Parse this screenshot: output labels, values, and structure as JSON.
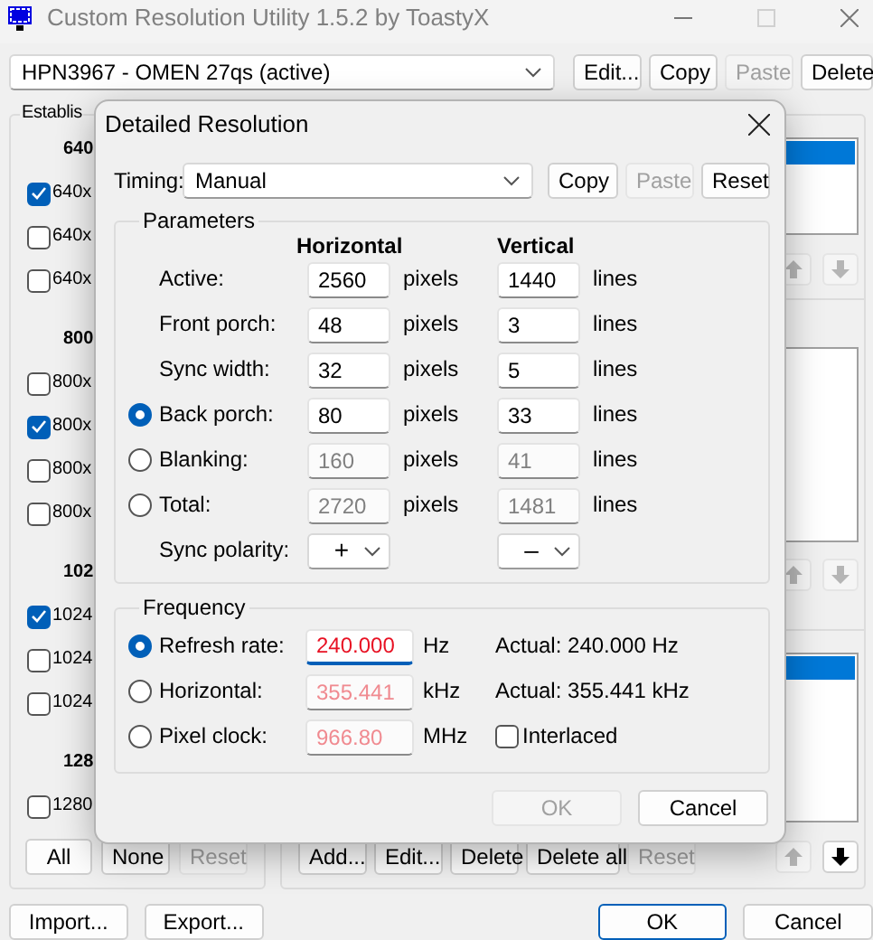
{
  "window": {
    "title": "Custom Resolution Utility 1.5.2 by ToastyX",
    "maximize_disabled": true
  },
  "monitor": {
    "value": "HPN3967 - OMEN 27qs (active)"
  },
  "monitor_buttons": [
    {
      "label": "Edit...",
      "disabled": false
    },
    {
      "label": "Copy",
      "disabled": false
    },
    {
      "label": "Paste",
      "disabled": true
    },
    {
      "label": "Delete",
      "disabled": false
    }
  ],
  "established": {
    "title": "Establis",
    "groups": [
      {
        "header": "640",
        "items": [
          {
            "label": "640x",
            "checked": true
          },
          {
            "label": "640x",
            "checked": false
          },
          {
            "label": "640x",
            "checked": false
          }
        ]
      },
      {
        "header": "800",
        "items": [
          {
            "label": "800x",
            "checked": false
          },
          {
            "label": "800x",
            "checked": true
          },
          {
            "label": "800x",
            "checked": false
          },
          {
            "label": "800x",
            "checked": false
          }
        ]
      },
      {
        "header": "102",
        "items": [
          {
            "label": "1024",
            "checked": true
          },
          {
            "label": "1024",
            "checked": false
          },
          {
            "label": "1024",
            "checked": false
          }
        ]
      },
      {
        "header": "128",
        "items": [
          {
            "label": "1280",
            "checked": false
          }
        ]
      }
    ],
    "buttons": [
      {
        "label": "All",
        "disabled": false
      },
      {
        "label": "None",
        "disabled": false
      },
      {
        "label": "Reset",
        "disabled": true
      }
    ]
  },
  "right_panel": {
    "lists": [
      {
        "selected": true,
        "up_disabled": true,
        "down_disabled": true
      },
      {
        "selected": false,
        "up_disabled": true,
        "down_disabled": true
      },
      {
        "selected": true,
        "up_disabled": true,
        "down_disabled": false
      }
    ],
    "buttons": [
      {
        "label": "Add...",
        "disabled": false
      },
      {
        "label": "Edit...",
        "disabled": false
      },
      {
        "label": "Delete",
        "disabled": false
      },
      {
        "label": "Delete all",
        "disabled": false
      },
      {
        "label": "Reset",
        "disabled": true
      }
    ]
  },
  "bottom_buttons": [
    {
      "label": "Import...",
      "default": false
    },
    {
      "label": "Export...",
      "default": false
    },
    {
      "label": "OK",
      "default": true
    },
    {
      "label": "Cancel",
      "default": false
    }
  ],
  "dialog": {
    "title": "Detailed Resolution",
    "timing": {
      "label": "Timing:",
      "value": "Manual"
    },
    "timing_buttons": [
      {
        "label": "Copy",
        "disabled": false
      },
      {
        "label": "Paste",
        "disabled": true
      },
      {
        "label": "Reset",
        "disabled": false
      }
    ],
    "parameters": {
      "title": "Parameters",
      "headers": [
        "Horizontal",
        "Vertical"
      ],
      "rows": [
        {
          "kind": "plain",
          "label": "Active:",
          "h_value": "2560",
          "h_unit": "pixels",
          "v_value": "1440",
          "v_unit": "lines",
          "disabled": false
        },
        {
          "kind": "plain",
          "label": "Front porch:",
          "h_value": "48",
          "h_unit": "pixels",
          "v_value": "3",
          "v_unit": "lines",
          "disabled": false
        },
        {
          "kind": "plain",
          "label": "Sync width:",
          "h_value": "32",
          "h_unit": "pixels",
          "v_value": "5",
          "v_unit": "lines",
          "disabled": false
        },
        {
          "kind": "radio",
          "selected": true,
          "label": "Back porch:",
          "h_value": "80",
          "h_unit": "pixels",
          "v_value": "33",
          "v_unit": "lines",
          "disabled": false
        },
        {
          "kind": "radio",
          "selected": false,
          "label": "Blanking:",
          "h_value": "160",
          "h_unit": "pixels",
          "v_value": "41",
          "v_unit": "lines",
          "disabled": true
        },
        {
          "kind": "radio",
          "selected": false,
          "label": "Total:",
          "h_value": "2720",
          "h_unit": "pixels",
          "v_value": "1481",
          "v_unit": "lines",
          "disabled": true
        }
      ],
      "polarity": {
        "label": "Sync polarity:",
        "h": "+",
        "v": "–"
      }
    },
    "frequency": {
      "title": "Frequency",
      "rows": [
        {
          "label": "Refresh rate:",
          "selected": true,
          "value": "240.000",
          "unit": "Hz",
          "disabled": false,
          "focused": true,
          "note": "Actual: 240.000 Hz"
        },
        {
          "label": "Horizontal:",
          "selected": false,
          "value": "355.441",
          "unit": "kHz",
          "disabled": true,
          "focused": false,
          "note": "Actual: 355.441 kHz"
        },
        {
          "label": "Pixel clock:",
          "selected": false,
          "value": "966.80",
          "unit": "MHz",
          "disabled": true,
          "focused": false,
          "checkbox": {
            "label": "Interlaced",
            "checked": false
          }
        }
      ]
    },
    "buttons": [
      {
        "label": "OK",
        "disabled": true
      },
      {
        "label": "Cancel",
        "disabled": false
      }
    ]
  }
}
